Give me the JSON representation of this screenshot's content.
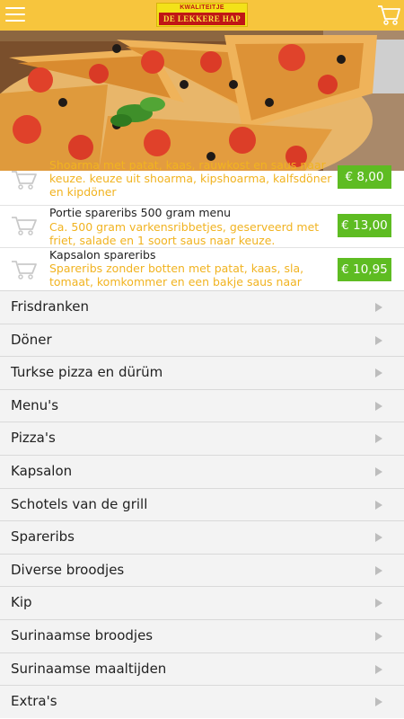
{
  "header": {
    "logo_top": "KWALITEITJE",
    "logo_main": "DE LEKKERE HAP",
    "menu_icon": "hamburger-menu-icon",
    "cart_icon": "shopping-cart-icon",
    "bar_color": "#f7c53d"
  },
  "products": [
    {
      "name": "",
      "description": "Shoarma met patat, kaas, rauwkost en saus naar keuze. keuze uit shoarma, kipshoarma, kalfsdöner en kipdöner",
      "price": "€ 8,00"
    },
    {
      "name": "Portie spareribs 500 gram menu",
      "description": "Ca. 500 gram varkensribbetjes, geserveerd met friet, salade en 1 soort saus naar keuze.",
      "price": "€ 13,00"
    },
    {
      "name": "Kapsalon spareribs",
      "description": "Spareribs zonder botten met patat, kaas, sla, tomaat, komkommer en een bakje saus naar keuze",
      "price": "€ 10,95"
    }
  ],
  "categories": [
    {
      "label": "Frisdranken"
    },
    {
      "label": "Döner"
    },
    {
      "label": "Turkse pizza en dürüm"
    },
    {
      "label": "Menu's"
    },
    {
      "label": "Pizza's"
    },
    {
      "label": "Kapsalon"
    },
    {
      "label": "Schotels van de grill"
    },
    {
      "label": "Spareribs"
    },
    {
      "label": "Diverse broodjes"
    },
    {
      "label": "Kip"
    },
    {
      "label": "Surinaamse broodjes"
    },
    {
      "label": "Surinaamse maaltijden"
    },
    {
      "label": "Extra's"
    }
  ],
  "colors": {
    "accent": "#f7c53d",
    "price_bg": "#5ebc22",
    "description": "#f1b320"
  }
}
